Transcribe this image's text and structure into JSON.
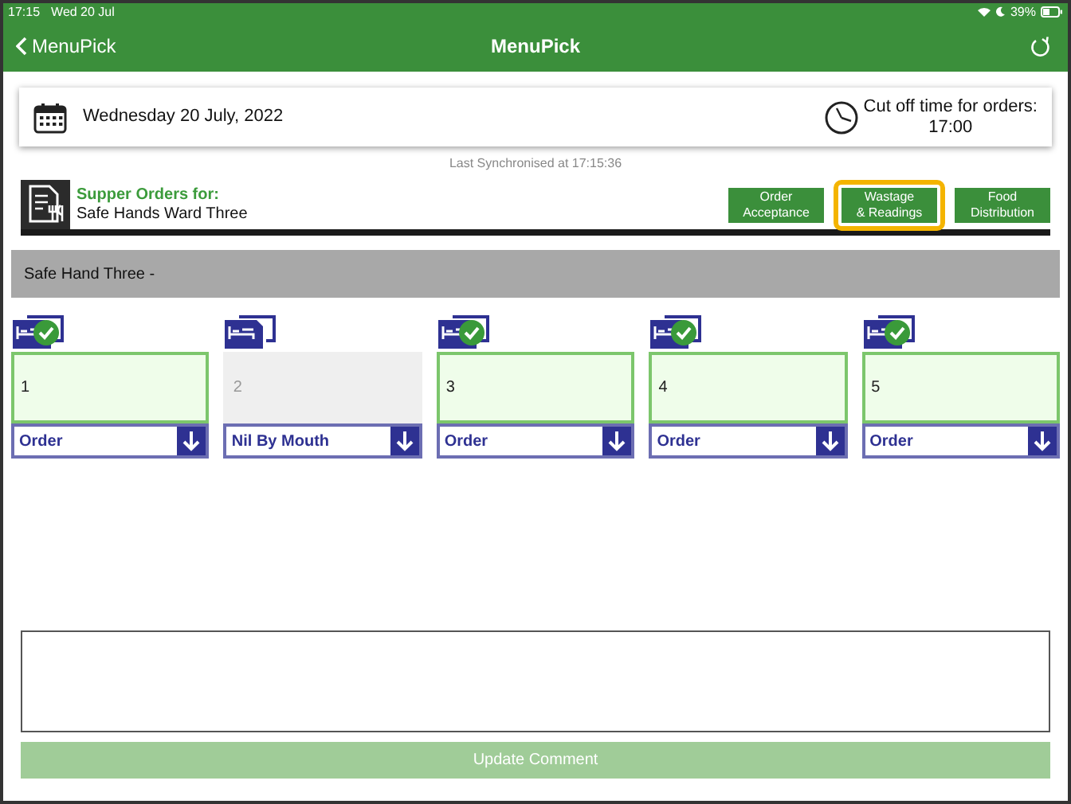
{
  "status_bar": {
    "time": "17:15",
    "date": "Wed 20 Jul",
    "battery": "39%"
  },
  "nav": {
    "back": "MenuPick",
    "title": "MenuPick"
  },
  "date_card": {
    "date": "Wednesday 20 July, 2022",
    "cutoff_label": "Cut off time for orders:",
    "cutoff_time": "17:00"
  },
  "sync": "Last Synchronised at 17:15:36",
  "header": {
    "title": "Supper Orders for:",
    "ward": "Safe Hands Ward Three"
  },
  "tabs": [
    {
      "label": "Order\nAcceptance",
      "selected": false
    },
    {
      "label": "Wastage\n& Readings",
      "selected": true
    },
    {
      "label": "Food\nDistribution",
      "selected": false
    }
  ],
  "section": "Safe Hand Three -",
  "beds": [
    {
      "number": "1",
      "ordered": true,
      "choice": "Order"
    },
    {
      "number": "2",
      "ordered": false,
      "choice": "Nil By Mouth"
    },
    {
      "number": "3",
      "ordered": true,
      "choice": "Order"
    },
    {
      "number": "4",
      "ordered": true,
      "choice": "Order"
    },
    {
      "number": "5",
      "ordered": true,
      "choice": "Order"
    }
  ],
  "update_button": {
    "label": "Update Comment",
    "disabled": true
  }
}
